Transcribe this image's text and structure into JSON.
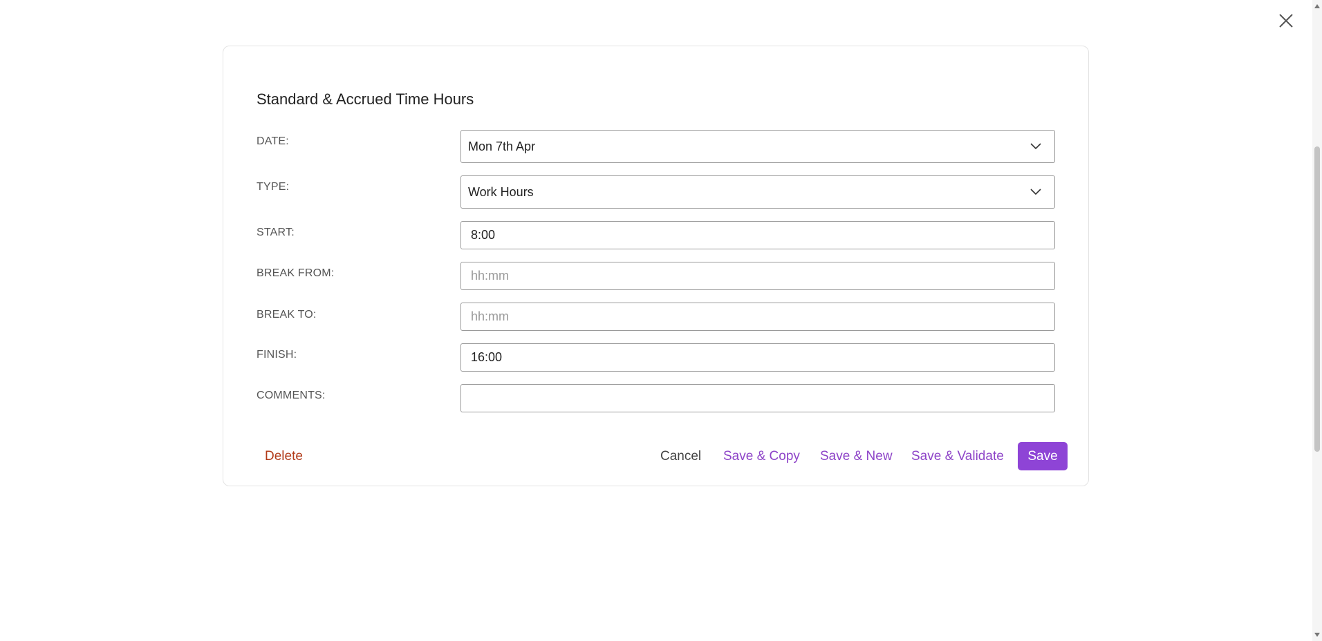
{
  "dialog": {
    "title": "Standard & Accrued Time Hours"
  },
  "form": {
    "date": {
      "label": "DATE:",
      "value": "Mon 7th Apr"
    },
    "type": {
      "label": "TYPE:",
      "value": "Work Hours"
    },
    "start": {
      "label": "START:",
      "value": "8:00",
      "placeholder": "hh:mm"
    },
    "break_from": {
      "label": "BREAK FROM:",
      "value": "",
      "placeholder": "hh:mm"
    },
    "break_to": {
      "label": "BREAK TO:",
      "value": "",
      "placeholder": "hh:mm"
    },
    "finish": {
      "label": "FINISH:",
      "value": "16:00",
      "placeholder": "hh:mm"
    },
    "comments": {
      "label": "COMMENTS:",
      "value": "",
      "placeholder": ""
    }
  },
  "actions": {
    "delete": "Delete",
    "cancel": "Cancel",
    "save_copy": "Save & Copy",
    "save_new": "Save & New",
    "save_validate": "Save & Validate",
    "save": "Save"
  },
  "icons": {
    "close": "close-icon",
    "dropdown": "chevron-down-icon"
  },
  "colors": {
    "accent": "#8e44d6",
    "link": "#8e44c8",
    "danger": "#b23b1a"
  }
}
